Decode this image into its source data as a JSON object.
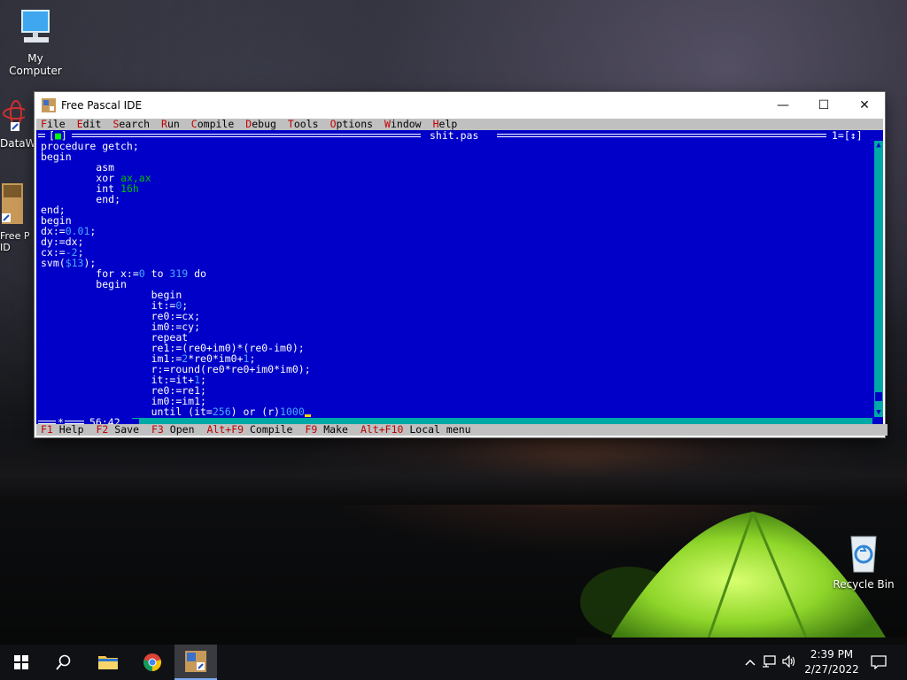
{
  "desktop": {
    "icons": [
      {
        "label": "My Computer"
      },
      {
        "label": "DataW"
      },
      {
        "label": "Free P\nID"
      },
      {
        "label": "Recycle Bin"
      }
    ]
  },
  "window": {
    "title": "Free Pascal IDE",
    "minimize": "—",
    "maximize": "☐",
    "close": "✕"
  },
  "ide": {
    "menu": [
      {
        "hot": "F",
        "rest": "ile"
      },
      {
        "hot": "E",
        "rest": "dit"
      },
      {
        "hot": "S",
        "rest": "earch"
      },
      {
        "hot": "R",
        "rest": "un"
      },
      {
        "hot": "C",
        "rest": "ompile"
      },
      {
        "hot": "D",
        "rest": "ebug"
      },
      {
        "hot": "T",
        "rest": "ools"
      },
      {
        "hot": "O",
        "rest": "ptions"
      },
      {
        "hot": "W",
        "rest": "indow"
      },
      {
        "hot": "H",
        "rest": "elp"
      }
    ],
    "editor": {
      "file_name": "shit.pas",
      "close_box": "[■]",
      "window_number": "1=[↕]",
      "cursor_position": "56:42",
      "bottom_left": "*",
      "lines": [
        "procedure getch;",
        "begin",
        "         asm",
        "         xor ax,ax",
        "         int 16h",
        "         end;",
        "end;",
        "begin",
        "dx:=0.01;",
        "dy:=dx;",
        "cx:=-2;",
        "svm($13);",
        "         for x:=0 to 319 do",
        "         begin",
        "                  begin",
        "                  it:=0;",
        "                  re0:=cx;",
        "                  im0:=cy;",
        "                  repeat",
        "                  re1:=(re0+im0)*(re0-im0);",
        "                  im1:=2*re0*im0+1;",
        "                  r:=round(re0*re0+im0*im0);",
        "                  it:=it+1;",
        "                  re0:=re1;",
        "                  im0:=im1;",
        "                  until (it=256) or (r)1000"
      ]
    },
    "status": [
      {
        "key": "F1",
        "label": "Help"
      },
      {
        "key": "F2",
        "label": "Save"
      },
      {
        "key": "F3",
        "label": "Open"
      },
      {
        "key": "Alt+F9",
        "label": "Compile"
      },
      {
        "key": "F9",
        "label": "Make"
      },
      {
        "key": "Alt+F10",
        "label": "Local menu"
      }
    ]
  },
  "taskbar": {
    "time": "2:39 PM",
    "date": "2/27/2022"
  }
}
